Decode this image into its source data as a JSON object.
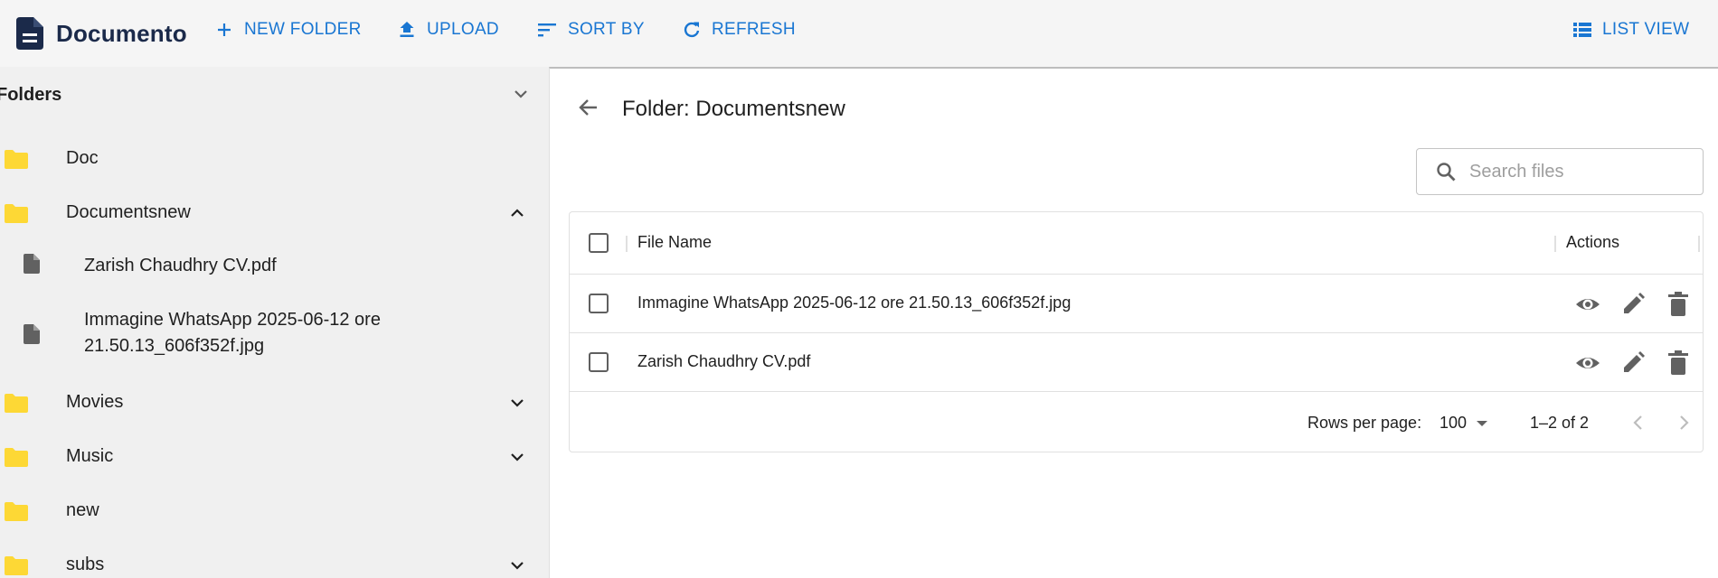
{
  "app": {
    "name": "Documento",
    "logo_icon": "document-icon"
  },
  "toolbar": {
    "new_folder": "NEW FOLDER",
    "upload": "UPLOAD",
    "sort_by": "SORT BY",
    "refresh": "REFRESH",
    "list_view": "LIST VIEW",
    "accent_color": "#1976d2"
  },
  "sidebar": {
    "title": "Folders",
    "folder_color": "#fdd835",
    "items": [
      {
        "label": "Doc",
        "type": "folder",
        "expandable": false
      },
      {
        "label": "Documentsnew",
        "type": "folder",
        "expandable": true,
        "expanded": true,
        "files": [
          {
            "label": "Zarish Chaudhry CV.pdf"
          },
          {
            "label": "Immagine WhatsApp 2025-06-12 ore 21.50.13_606f352f.jpg"
          }
        ]
      },
      {
        "label": "Movies",
        "type": "folder",
        "expandable": true,
        "expanded": false
      },
      {
        "label": "Music",
        "type": "folder",
        "expandable": true,
        "expanded": false
      },
      {
        "label": "new",
        "type": "folder",
        "expandable": false
      },
      {
        "label": "subs",
        "type": "folder",
        "expandable": true,
        "expanded": false
      }
    ]
  },
  "main": {
    "title": "Folder: Documentsnew",
    "search_placeholder": "Search files",
    "columns": {
      "file_name": "File Name",
      "actions": "Actions"
    },
    "rows": [
      {
        "name": "Immagine WhatsApp 2025-06-12 ore 21.50.13_606f352f.jpg"
      },
      {
        "name": "Zarish Chaudhry CV.pdf"
      }
    ],
    "pagination": {
      "rows_per_page_label": "Rows per page:",
      "rows_per_page": "100",
      "range": "1–2 of 2"
    }
  }
}
